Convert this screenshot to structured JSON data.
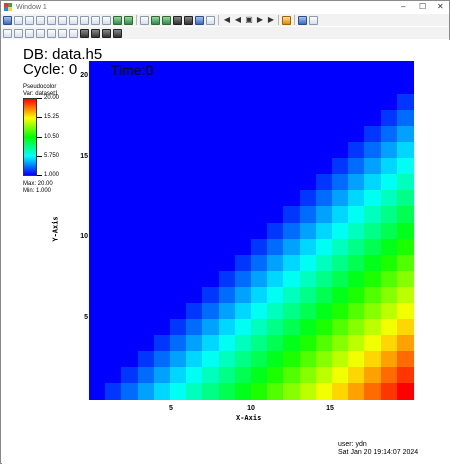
{
  "window": {
    "title": "Window 1",
    "minimize_icon": "minimize-icon",
    "maximize_icon": "maximize-icon",
    "close_icon": "close-icon"
  },
  "toolbar": {
    "row1_icons": [
      "window-icon",
      "select-icon",
      "new-window-icon",
      "copy-icon",
      "frame-icon",
      "layout-1-icon",
      "layout-2-icon",
      "layout-3-icon",
      "layout-4-icon",
      "layout-5-icon",
      "layout-6-icon",
      "plot-icon",
      "operator-icon",
      "copy-plot-icon",
      "draw-icon",
      "hide-icon",
      "delete-icon",
      "clear-icon",
      "redraw-icon",
      "animation-icon",
      "first-frame-icon",
      "rewind-icon",
      "stop-icon",
      "play-icon",
      "last-frame-icon",
      "save-icon",
      "lock-icon",
      "lock2-icon"
    ],
    "row2_icons": [
      "navigate-icon",
      "zoom-icon",
      "lineout-icon",
      "pick-icon",
      "pick-node-icon",
      "line-icon",
      "point-icon",
      "plane-icon",
      "sphere-icon",
      "box-icon",
      "cylinder-icon"
    ]
  },
  "overlay": {
    "db_label": "DB: data.h5",
    "cycle_label": "Cycle: 0",
    "time_label": "Time:0",
    "legend_title": "Pseudocolor",
    "legend_var": "Var: dataset1",
    "legend_ticks": [
      "20.00",
      "15.25",
      "10.50",
      "5.750",
      "1.000"
    ],
    "legend_max": "Max:  20.00",
    "legend_min": "Min:  1.000",
    "user": "user: ydn",
    "date": "Sat Jan 20 19:14:07 2024"
  },
  "colors": {
    "low": "#0000ff",
    "mid_low": "#00ffff",
    "mid": "#00ff00",
    "mid_high": "#ffff00",
    "high": "#ff0000"
  },
  "chart_data": {
    "type": "heatmap",
    "xlabel": "X-Axis",
    "ylabel": "Y-Axis",
    "x_ticks": [
      "5",
      "10",
      "15"
    ],
    "y_ticks": [
      "20",
      "15",
      "10",
      "5"
    ],
    "xlim": [
      0,
      20
    ],
    "ylim": [
      0,
      21
    ],
    "value_range": [
      1,
      20
    ],
    "grid": false,
    "description_rule": "value = 1 + (x - y) for x > y, else 1 (upper-left triangle uniform minimum)"
  }
}
